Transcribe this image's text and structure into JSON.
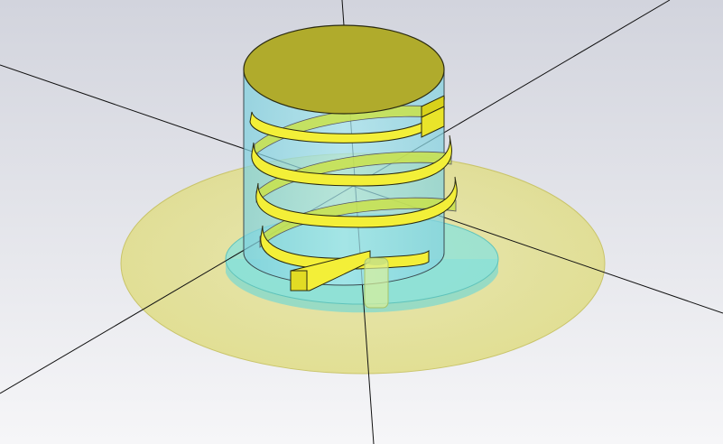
{
  "scene": {
    "type": "3d-model-view",
    "model": "helical-antenna",
    "helix_turns_visible": 4,
    "colors": {
      "background_top": "#d2d4dd",
      "background_bottom": "#f6f6f8",
      "ground_plane": "#e6e28c",
      "ground_plane_edge": "#c9c46a",
      "substrate": "#86dfd9",
      "cylinder": "#8fdbe6",
      "cap": "#b0ab2c",
      "helix": "#f2ee36",
      "helix_inner": "#cfca12",
      "axis_line": "#111111"
    }
  }
}
